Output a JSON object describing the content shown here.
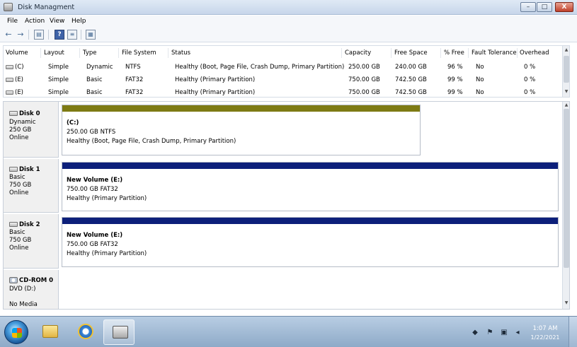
{
  "window": {
    "title": "Disk Managment",
    "controls": {
      "minimize": "–",
      "maximize": "□",
      "close": "X"
    }
  },
  "menu": [
    "File",
    "Action",
    "View",
    "Help"
  ],
  "toolbar": {
    "back": "←",
    "forward": "→",
    "help": "?"
  },
  "volumes": {
    "columns": [
      "Volume",
      "Layout",
      "Type",
      "File System",
      "Status",
      "Capacity",
      "Free Space",
      "% Free",
      "Fault Tolerance",
      "Overhead"
    ],
    "rows": [
      {
        "volume": "(C)",
        "layout": "Simple",
        "type": "Dynamic",
        "fs": "NTFS",
        "status": "Healthy (Boot, Page File, Crash Dump, Primary Partition)",
        "capacity": "250.00 GB",
        "free": "240.00 GB",
        "pct": "96 %",
        "fault": "No",
        "overhead": "0 %"
      },
      {
        "volume": "(E)",
        "layout": "Simple",
        "type": "Basic",
        "fs": "FAT32",
        "status": "Healthy (Primary Partition)",
        "capacity": "750.00 GB",
        "free": "742.50 GB",
        "pct": "99 %",
        "fault": "No",
        "overhead": "0 %"
      },
      {
        "volume": "(E)",
        "layout": "Simple",
        "type": "Basic",
        "fs": "FAT32",
        "status": "Healthy (Primary Partition)",
        "capacity": "750.00 GB",
        "free": "742.50 GB",
        "pct": "99 %",
        "fault": "No",
        "overhead": "0 %"
      }
    ]
  },
  "disks": [
    {
      "name": "Disk 0",
      "kind": "Dynamic",
      "size": "250 GB",
      "state": "Online",
      "partition": {
        "name": "(C:)",
        "size_fs": "250.00 GB  NTFS",
        "status": "Healthy (Boot, Page File, Crash Dump, Primary Partition)"
      }
    },
    {
      "name": "Disk 1",
      "kind": "Basic",
      "size": "750 GB",
      "state": "Online",
      "partition": {
        "name": "New Volume (E:)",
        "size_fs": "750.00 GB  FAT32",
        "status": "Healthy (Primary Partition)"
      }
    },
    {
      "name": "Disk 2",
      "kind": "Basic",
      "size": "750 GB",
      "state": "Online",
      "partition": {
        "name": "New Volume (E:)",
        "size_fs": "750.00 GB  FAT32",
        "status": "Healthy (Primary Partition)"
      }
    },
    {
      "name": "CD-ROM 0",
      "kind": "DVD (D:)",
      "size": "",
      "state": "No Media"
    }
  ],
  "taskbar": {
    "time": "1:07 AM",
    "date": "1/22/2021"
  },
  "colors": {
    "bar_dynamic": "#7e7b14",
    "bar_basic": "#0c1f7a",
    "titlebar": "#c7d6ea"
  }
}
